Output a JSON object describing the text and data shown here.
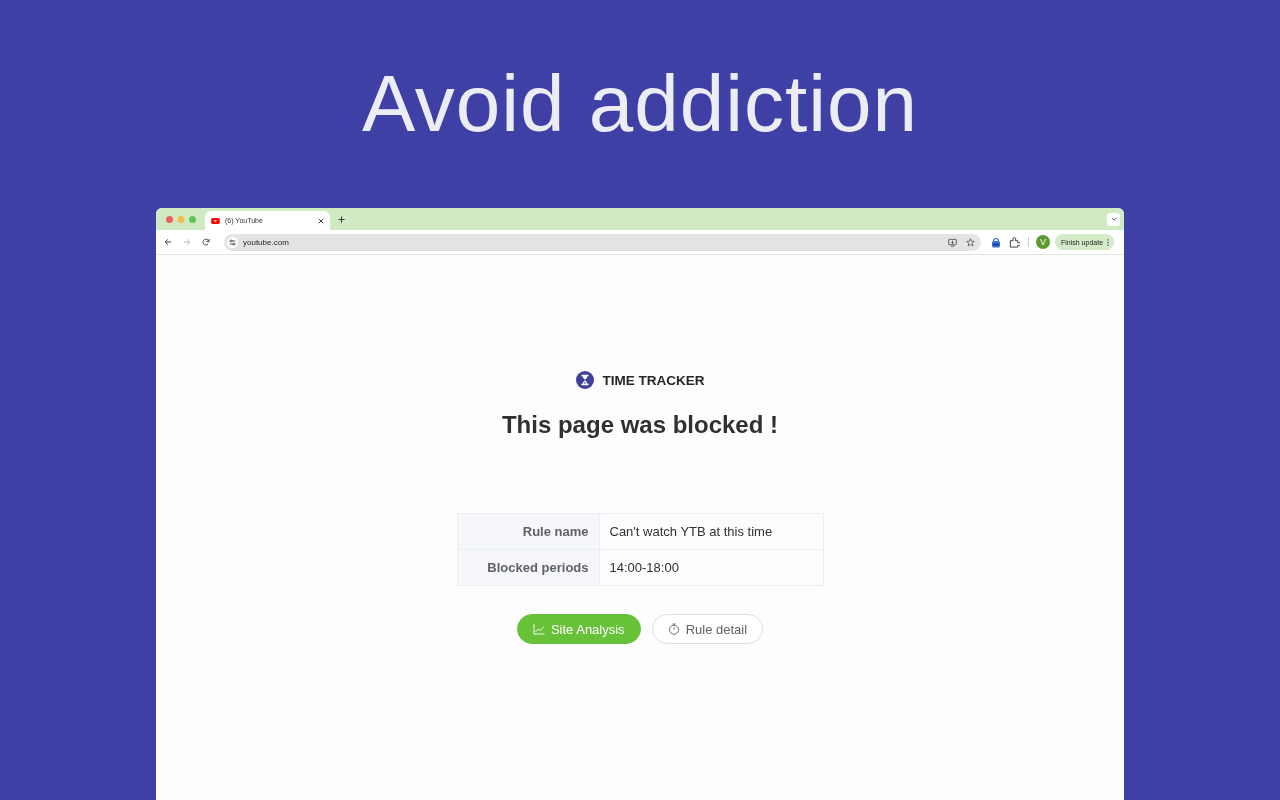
{
  "headline": "Avoid addiction",
  "browser": {
    "tabs": [
      {
        "title": "(6) YouTube",
        "selected": true
      }
    ],
    "forward_disabled": true,
    "address": "youtube.com",
    "profile_initial": "V",
    "update_button": "Finish update"
  },
  "page": {
    "brand": "TIME TRACKER",
    "title": "This page was blocked !",
    "details": [
      {
        "label": "Rule name",
        "value": "Can't watch YTB at this time"
      },
      {
        "label": "Blocked periods",
        "value": "14:00-18:00"
      }
    ],
    "buttons": [
      {
        "kind": "primary",
        "label": "Site Analysis"
      },
      {
        "kind": "secondary",
        "label": "Rule detail"
      }
    ]
  }
}
